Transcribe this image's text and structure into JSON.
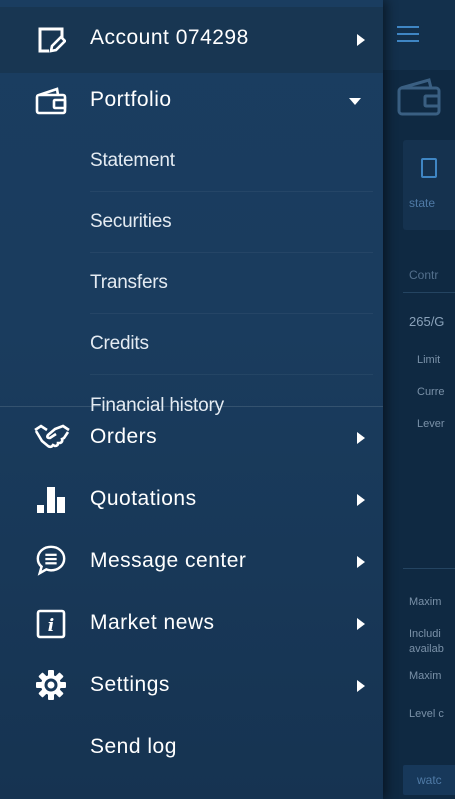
{
  "background_app": {
    "statement_tab_label": "state",
    "contract_header": "Contr",
    "contract_number": "265/G",
    "rows": [
      "Limit",
      "Curre",
      "Lever"
    ],
    "bottom_rows": [
      "Maxim",
      "Includi",
      "availab",
      "Maxim",
      "Level c"
    ],
    "button_label": "watc"
  },
  "drawer": {
    "account": {
      "label": "Account 074298",
      "icon": "account-edit-icon"
    },
    "portfolio": {
      "label": "Portfolio",
      "icon": "wallet-icon",
      "expanded": true,
      "items": [
        {
          "label": "Statement"
        },
        {
          "label": "Securities"
        },
        {
          "label": "Transfers"
        },
        {
          "label": "Credits"
        },
        {
          "label": "Financial history"
        }
      ]
    },
    "items": [
      {
        "label": "Orders",
        "icon": "handshake-icon"
      },
      {
        "label": "Quotations",
        "icon": "bar-chart-icon"
      },
      {
        "label": "Message center",
        "icon": "message-icon"
      },
      {
        "label": "Market news",
        "icon": "info-icon"
      },
      {
        "label": "Settings",
        "icon": "gear-icon"
      }
    ],
    "send_log": {
      "label": "Send log"
    }
  },
  "colors": {
    "drawer_bg": "#1a3c5e",
    "text": "#ffffff",
    "accent": "#3f86c4"
  }
}
